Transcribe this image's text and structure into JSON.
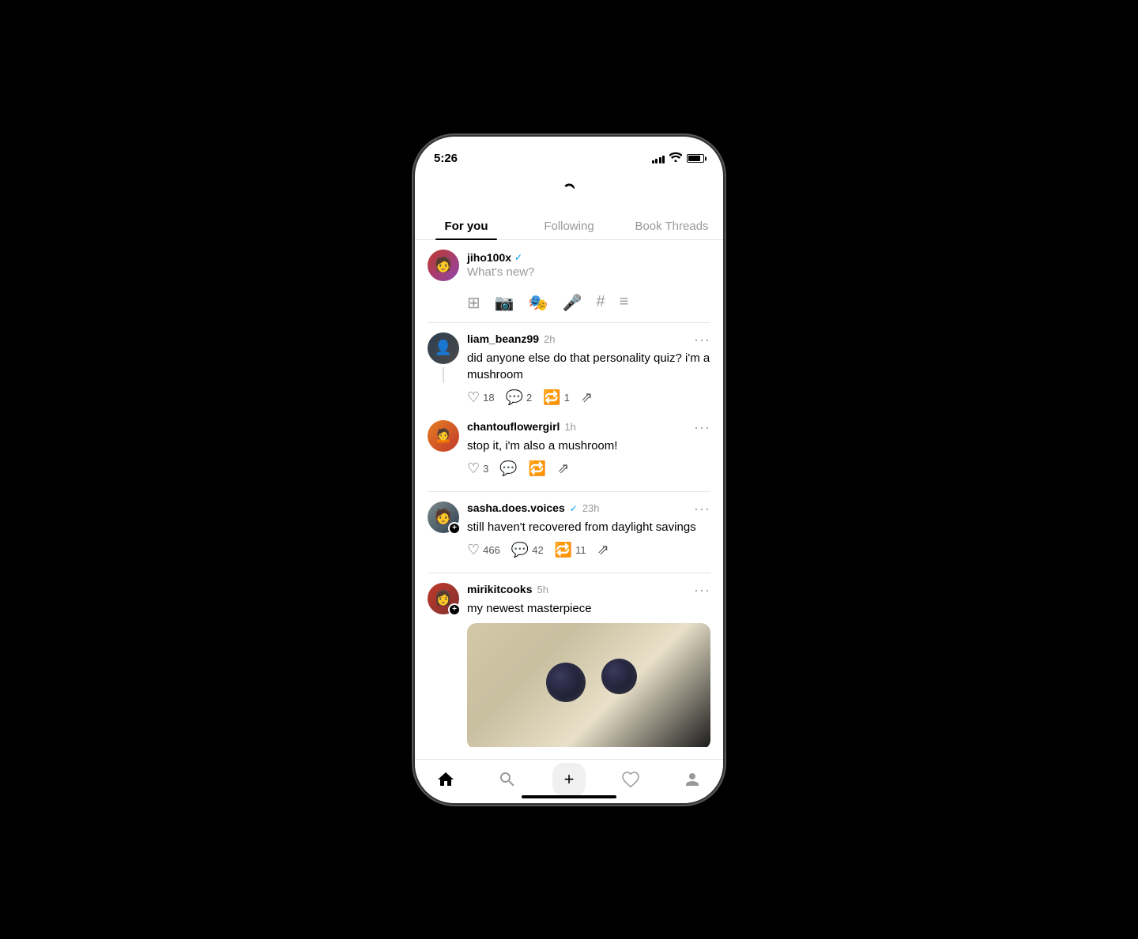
{
  "statusBar": {
    "time": "5:26"
  },
  "header": {
    "logoAlt": "Threads logo"
  },
  "tabs": [
    {
      "id": "for-you",
      "label": "For you",
      "active": true
    },
    {
      "id": "following",
      "label": "Following",
      "active": false
    },
    {
      "id": "book-threads",
      "label": "Book Threads",
      "active": false
    }
  ],
  "compose": {
    "username": "jiho100x",
    "verified": true,
    "placeholder": "What's new?"
  },
  "posts": [
    {
      "id": "post-1",
      "username": "liam_beanz99",
      "verified": false,
      "time": "2h",
      "text": "did anyone else do that personality quiz? i'm a mushroom",
      "likes": "18",
      "comments": "2",
      "reposts": "1",
      "hasThread": true,
      "reply": {
        "username": "chantouflowergirl",
        "verified": false,
        "time": "1h",
        "text": "stop it, i'm also a mushroom!",
        "likes": "3",
        "comments": "",
        "reposts": ""
      }
    },
    {
      "id": "post-2",
      "username": "sasha.does.voices",
      "verified": true,
      "time": "23h",
      "text": "still haven't recovered from daylight savings",
      "likes": "466",
      "comments": "42",
      "reposts": "11",
      "hasAdd": true
    },
    {
      "id": "post-3",
      "username": "mirikitcooks",
      "verified": false,
      "time": "5h",
      "text": "my newest masterpiece",
      "hasImage": true,
      "hasAdd": true
    }
  ],
  "bottomNav": {
    "items": [
      {
        "id": "home",
        "icon": "🏠",
        "active": true
      },
      {
        "id": "search",
        "icon": "🔍",
        "active": false
      },
      {
        "id": "compose",
        "icon": "+",
        "active": false
      },
      {
        "id": "activity",
        "icon": "♡",
        "active": false
      },
      {
        "id": "profile",
        "icon": "👤",
        "active": false
      }
    ]
  }
}
